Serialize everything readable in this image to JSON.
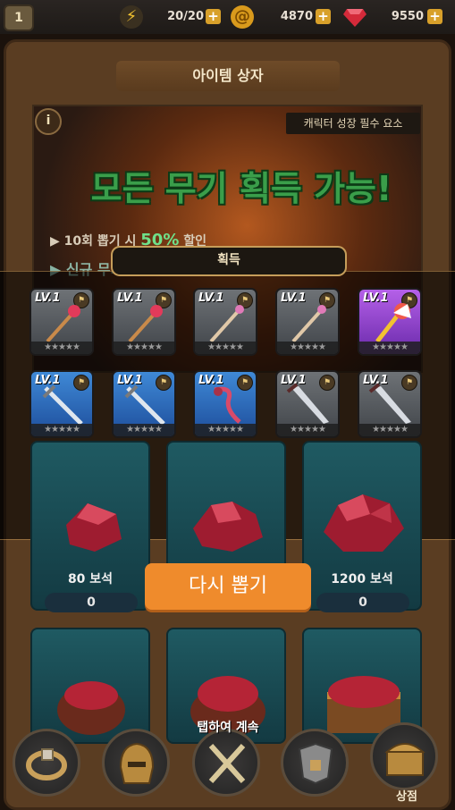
{
  "top_bar": {
    "level": "1",
    "energy": "20/20",
    "coins": "4870",
    "gems": "9550",
    "plus_label": "+"
  },
  "panel": {
    "title": "아이템 상자",
    "info_label": "i",
    "subtitle": "캐릭터 성장 필수 요소",
    "banner_title": "모든 무기 획득 가능!",
    "banner_line1_prefix": "10회 뽑기 시",
    "banner_line1_percent": "50%",
    "banner_line1_suffix": "할인",
    "banner_line2": "신규 무기 추가!",
    "acquire_label": "획득"
  },
  "items": [
    {
      "level": "LV.1",
      "rarity": "grey",
      "weapon": "staff-red",
      "stars": "★★★★★"
    },
    {
      "level": "LV.1",
      "rarity": "grey",
      "weapon": "staff-red",
      "stars": "★★★★★"
    },
    {
      "level": "LV.1",
      "rarity": "grey",
      "weapon": "staff-pink",
      "stars": "★★★★★"
    },
    {
      "level": "LV.1",
      "rarity": "grey",
      "weapon": "staff-pink",
      "stars": "★★★★★"
    },
    {
      "level": "LV.1",
      "rarity": "purple",
      "weapon": "staff-gold",
      "stars": "★★★★★"
    },
    {
      "level": "LV.1",
      "rarity": "blue",
      "weapon": "sword",
      "stars": "★★★★★"
    },
    {
      "level": "LV.1",
      "rarity": "blue",
      "weapon": "sword",
      "stars": "★★★★★"
    },
    {
      "level": "LV.1",
      "rarity": "blue",
      "weapon": "whip",
      "stars": "★★★★★"
    },
    {
      "level": "LV.1",
      "rarity": "grey",
      "weapon": "blade",
      "stars": "★★★★★"
    },
    {
      "level": "LV.1",
      "rarity": "grey",
      "weapon": "blade",
      "stars": "★★★★★"
    }
  ],
  "gem_cards": [
    {
      "label": "80 보석",
      "price": "0"
    },
    {
      "label": "",
      "price": ""
    },
    {
      "label": "1200 보석",
      "price": "0"
    }
  ],
  "retry_button": "다시 뽑기",
  "continue_text": "탭하여 계속",
  "bottom_nav": {
    "shop_label": "상점"
  },
  "colors": {
    "retry": "#ef8b2c",
    "banner_title": "#3a9e4a",
    "purple_item": "#b560e8",
    "blue_item": "#3f89d6",
    "grey_item": "#6e7276"
  }
}
